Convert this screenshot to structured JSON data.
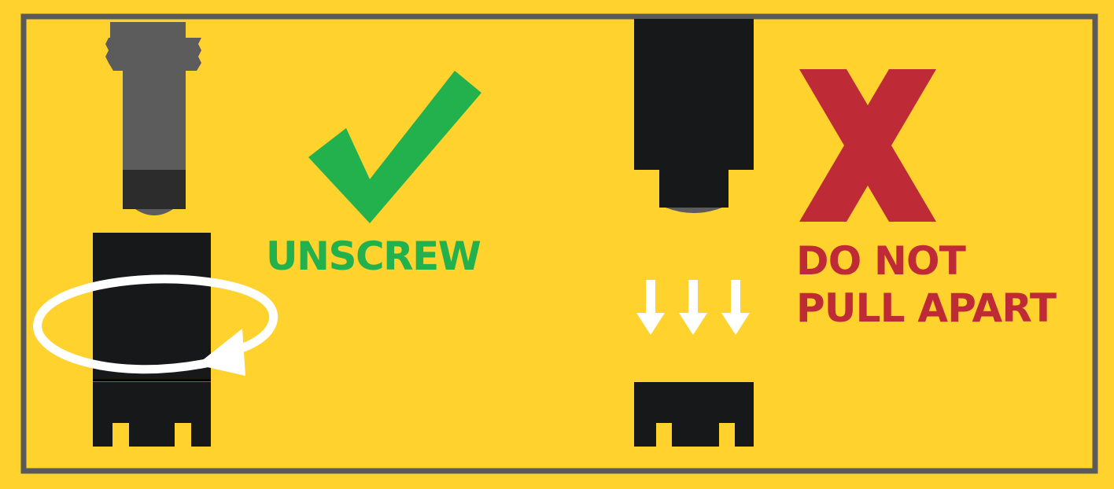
{
  "panel": {
    "background_color": "#ffd22e",
    "border_color": "#5a5a5a"
  },
  "correct": {
    "icon": "check-mark-icon",
    "label": "UNSCREW",
    "color": "#22b14c"
  },
  "incorrect": {
    "icon": "x-mark-icon",
    "label_line1": "DO NOT",
    "label_line2": "PULL APART",
    "color": "#be2a35"
  },
  "colors": {
    "probe_body": "#161819",
    "probe_tip": "#5c5c5c",
    "arrows": "#ffffff"
  }
}
